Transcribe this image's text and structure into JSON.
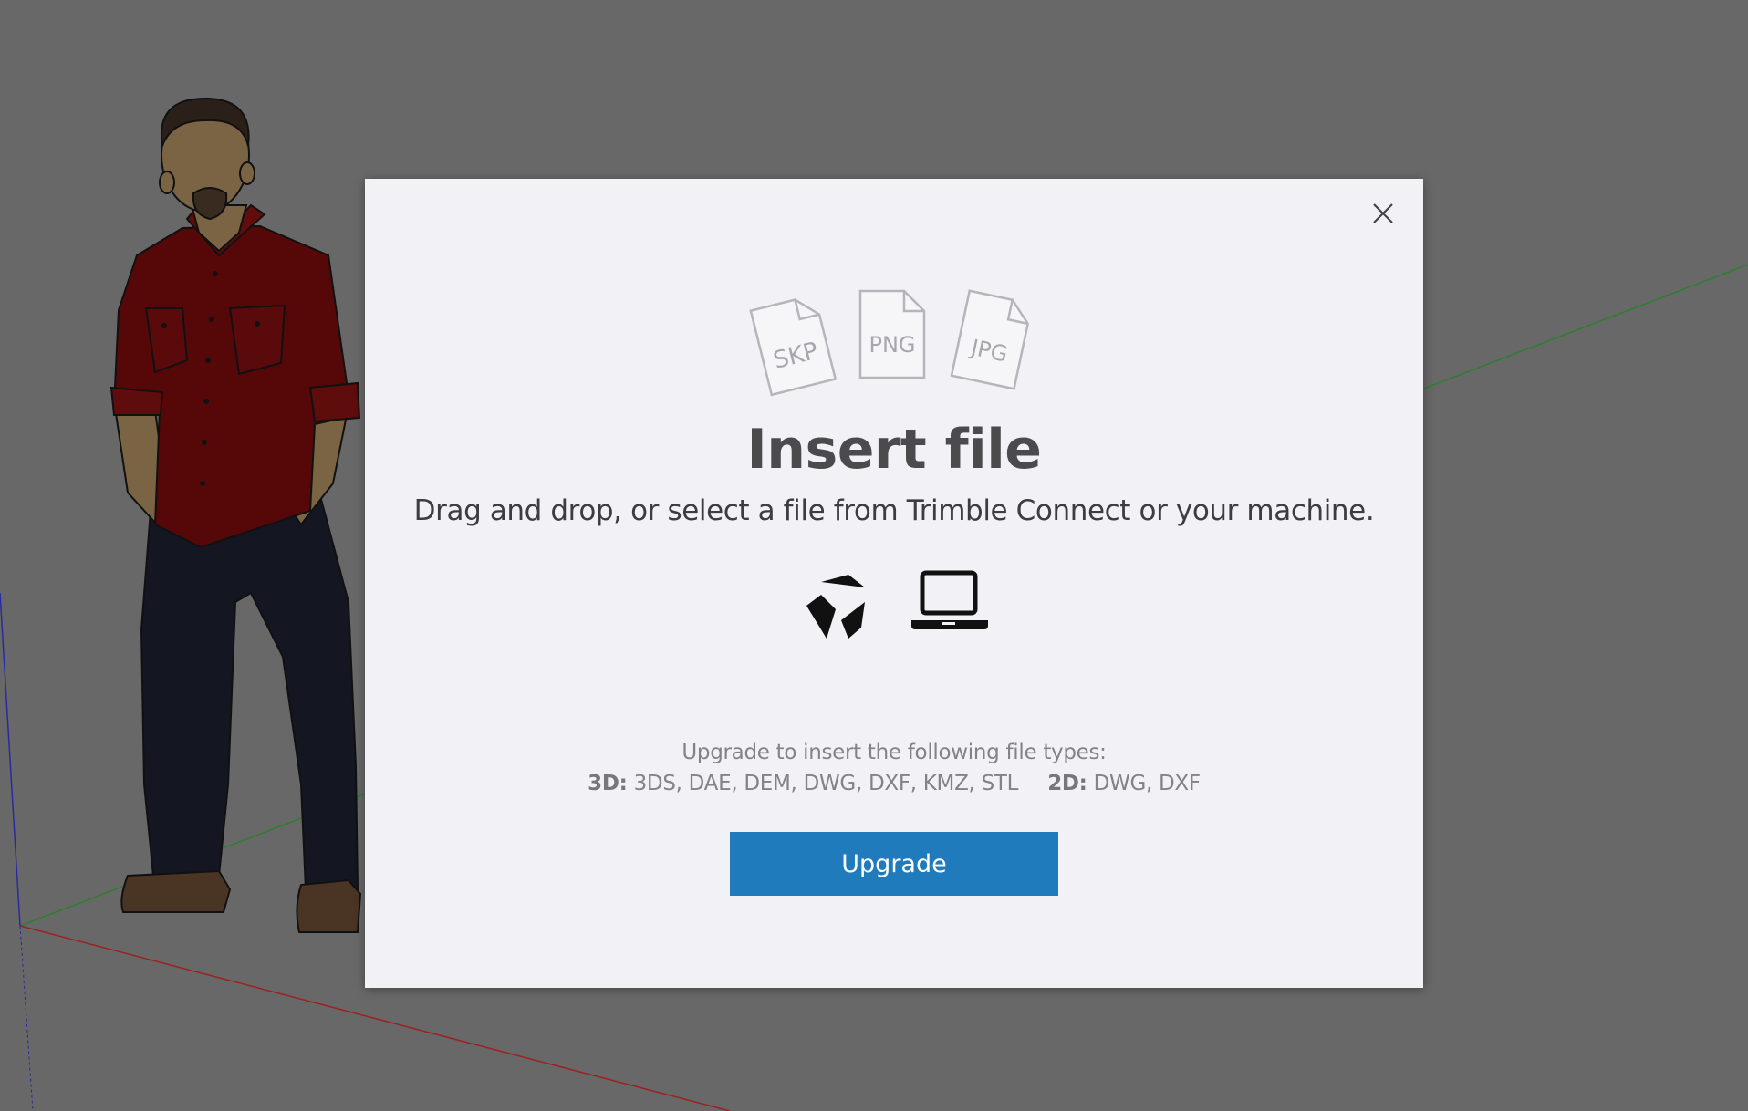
{
  "dialog": {
    "title": "Insert file",
    "subtitle": "Drag and drop, or select a file from Trimble Connect or your machine.",
    "file_types_icons": [
      "SKP",
      "PNG",
      "JPG"
    ],
    "close_icon": "close-icon",
    "sources": [
      {
        "name": "trimble-connect-icon"
      },
      {
        "name": "laptop-icon"
      }
    ],
    "upgrade_note": {
      "line1": "Upgrade to insert the following file types:",
      "label_3d": "3D:",
      "types_3d": "3DS, DAE, DEM, DWG, DXF, KMZ, STL",
      "label_2d": "2D:",
      "types_2d": "DWG, DXF"
    },
    "upgrade_button": "Upgrade"
  },
  "colors": {
    "background": "#686868",
    "dialog": "#f2f1f6",
    "accent": "#1f7bbb",
    "title": "#4b4b4d"
  }
}
